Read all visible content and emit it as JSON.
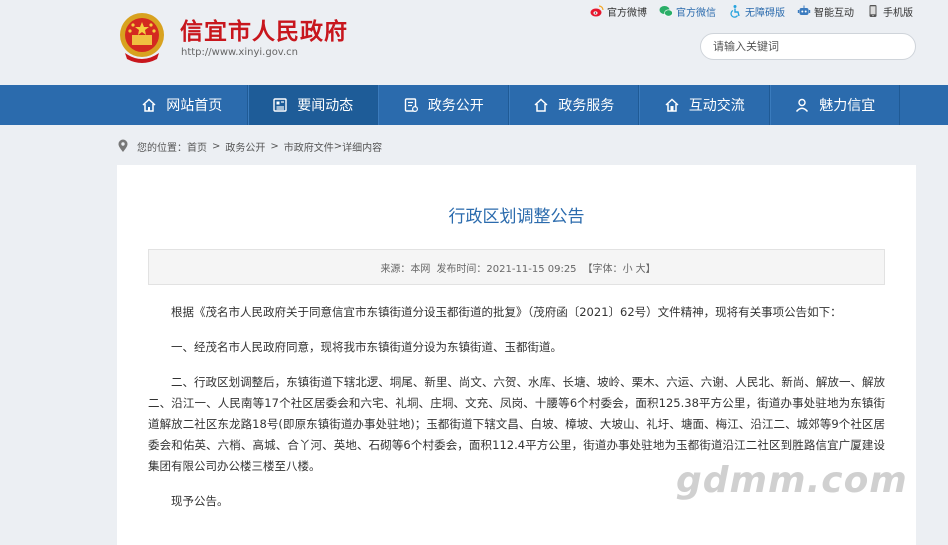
{
  "header": {
    "site_title": "信宜市人民政府",
    "site_url": "http://www.xinyi.gov.cn",
    "top_links": [
      {
        "label": "官方微博",
        "icon": "weibo-icon",
        "color": "#333333"
      },
      {
        "label": "官方微信",
        "icon": "wechat-icon",
        "color": "#2b6bad"
      },
      {
        "label": "无障碍版",
        "icon": "accessibility-icon",
        "color": "#2b6bad"
      },
      {
        "label": "智能互动",
        "icon": "robot-icon",
        "color": "#333333"
      },
      {
        "label": "手机版",
        "icon": "mobile-icon",
        "color": "#333333"
      }
    ],
    "search_placeholder": "请输入关键词"
  },
  "nav": {
    "items": [
      {
        "label": "网站首页",
        "icon": "home-icon"
      },
      {
        "label": "要闻动态",
        "icon": "news-icon"
      },
      {
        "label": "政务公开",
        "icon": "document-icon"
      },
      {
        "label": "政务服务",
        "icon": "service-icon"
      },
      {
        "label": "互动交流",
        "icon": "interact-icon"
      },
      {
        "label": "魅力信宜",
        "icon": "person-icon"
      }
    ],
    "active_index": 1
  },
  "breadcrumb": {
    "prefix": "您的位置：",
    "items": [
      "首页",
      "政务公开",
      "市政府文件"
    ],
    "current": "详细内容"
  },
  "article": {
    "title": "行政区划调整公告",
    "source": "来源：本网",
    "publish_time": "发布时间：2021-11-15 09:25",
    "font_size_label": "【字体：",
    "font_small": "小",
    "font_large": "大",
    "font_close": "】",
    "paragraphs": [
      "根据《茂名市人民政府关于同意信宜市东镇街道分设玉都街道的批复》（茂府函〔2021〕62号）文件精神，现将有关事项公告如下：",
      "一、经茂名市人民政府同意，现将我市东镇街道分设为东镇街道、玉都街道。",
      "二、行政区划调整后，东镇街道下辖北逻、垌尾、新里、尚文、六贺、水库、长塘、坡岭、栗木、六运、六谢、人民北、新尚、解放一、解放二、沿江一、人民南等17个社区居委会和六宅、礼垌、庄垌、文充、凤岗、十腰等6个村委会，面积125.38平方公里，街道办事处驻地为东镇街道解放二社区东龙路18号(即原东镇街道办事处驻地)；玉都街道下辖文昌、白坡、樟坡、大坡山、礼圩、塘面、梅江、沿江二、城郊等9个社区居委会和佑英、六梢、高城、合丫河、英地、石砌等6个村委会，面积112.4平方公里，街道办事处驻地为玉都街道沿江二社区到胜路信宜广厦建设集团有限公司办公楼三楼至八楼。",
      "现予公告。"
    ]
  },
  "watermark": "gdmm.com",
  "colors": {
    "brand_red": "#c8161d",
    "nav_blue": "#2b6bad",
    "nav_active": "#1e5c98",
    "page_bg": "#eceff3"
  }
}
